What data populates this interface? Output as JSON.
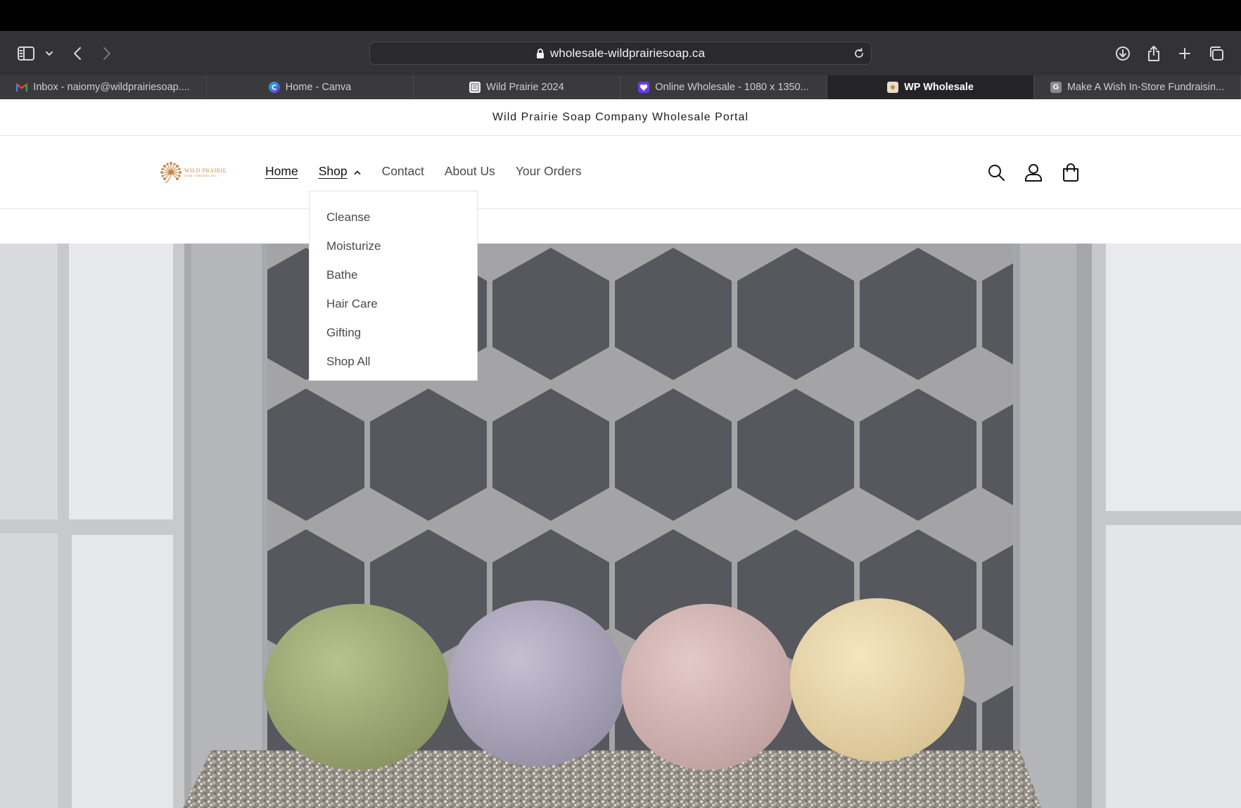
{
  "browser": {
    "url": "wholesale-wildprairiesoap.ca",
    "tabs": [
      {
        "label": "Inbox - naiomy@wildprairiesoap....",
        "favicon": "gmail-icon",
        "active": false
      },
      {
        "label": "Home - Canva",
        "favicon": "canva-icon",
        "active": false
      },
      {
        "label": "Wild Prairie 2024",
        "favicon": "document-icon",
        "active": false
      },
      {
        "label": "Online Wholesale - 1080 x 1350...",
        "favicon": "heart-icon",
        "active": false
      },
      {
        "label": "WP Wholesale",
        "favicon": "site-icon",
        "active": true
      },
      {
        "label": "Make A Wish In-Store Fundraisin...",
        "favicon": "g-icon",
        "active": false
      }
    ],
    "g_letter": "G"
  },
  "site": {
    "announcement": "Wild Prairie Soap Company Wholesale Portal",
    "logo": {
      "name": "WILD PRAIRIE",
      "sub": "soap company inc."
    },
    "nav": [
      {
        "label": "Home",
        "current": true
      },
      {
        "label": "Shop",
        "expanded": true
      },
      {
        "label": "Contact"
      },
      {
        "label": "About Us"
      },
      {
        "label": "Your Orders"
      }
    ],
    "shop_menu": [
      "Cleanse",
      "Moisturize",
      "Bathe",
      "Hair Care",
      "Gifting",
      "Shop All"
    ],
    "header_icons": [
      "search-icon",
      "account-icon",
      "cart-icon"
    ]
  },
  "hero": {
    "subject": "four round shampoo bars on a pebble shelf in front of hexagon tiles",
    "bar_colors": [
      "#a3ad79",
      "#b1abbf",
      "#d3b7b6",
      "#ead8ae"
    ]
  },
  "colors": {
    "logo_accent": "#c6894a",
    "tile_dark": "#55575c",
    "grout": "#a8a8aa"
  }
}
